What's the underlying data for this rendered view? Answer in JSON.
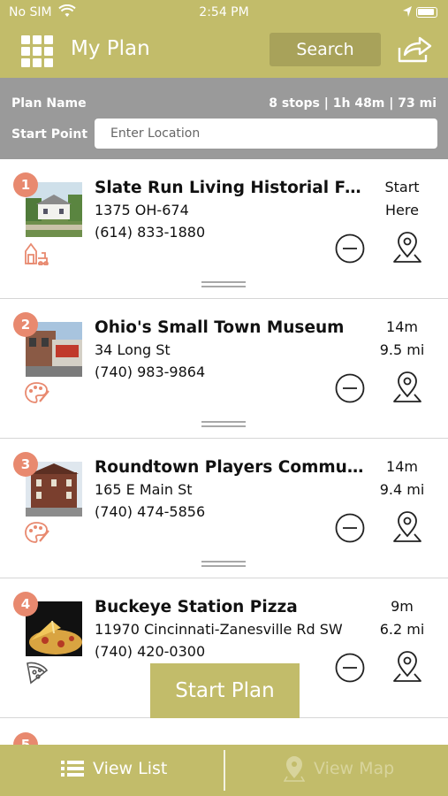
{
  "status_bar": {
    "carrier": "No SIM",
    "time": "2:54 PM"
  },
  "header": {
    "title": "My Plan",
    "search_label": "Search"
  },
  "plan": {
    "name_label": "Plan Name",
    "stats": "8 stops | 1h 48m | 73 mi",
    "start_point_label": "Start Point",
    "location_placeholder": "Enter Location"
  },
  "stops": [
    {
      "number": "1",
      "name": "Slate Run Living Historial Farm",
      "address": "1375 OH-674",
      "phone": "(614) 833-1880",
      "time": "Start",
      "distance": "Here",
      "category_icon": "farm-icon"
    },
    {
      "number": "2",
      "name": "Ohio's Small Town Museum",
      "address": "34 Long St",
      "phone": "(740) 983-9864",
      "time": "14m",
      "distance": "9.5 mi",
      "category_icon": "palette-icon"
    },
    {
      "number": "3",
      "name": "Roundtown Players Communi...",
      "address": "165 E Main St",
      "phone": "(740) 474-5856",
      "time": "14m",
      "distance": "9.4 mi",
      "category_icon": "palette-icon"
    },
    {
      "number": "4",
      "name": "Buckeye Station Pizza",
      "address": "11970 Cincinnati-Zanesville Rd SW",
      "phone": "(740) 420-0300",
      "time": "9m",
      "distance": "6.2 mi",
      "category_icon": "pizza-icon"
    }
  ],
  "partial_stop": {
    "number": "5"
  },
  "start_plan_label": "Start Plan",
  "tabs": {
    "list_label": "View List",
    "map_label": "View Map"
  },
  "colors": {
    "header": "#c2bc6a",
    "plan_panel": "#9a9a9a",
    "badge": "#e8896f",
    "search_button": "#a8a25a"
  }
}
